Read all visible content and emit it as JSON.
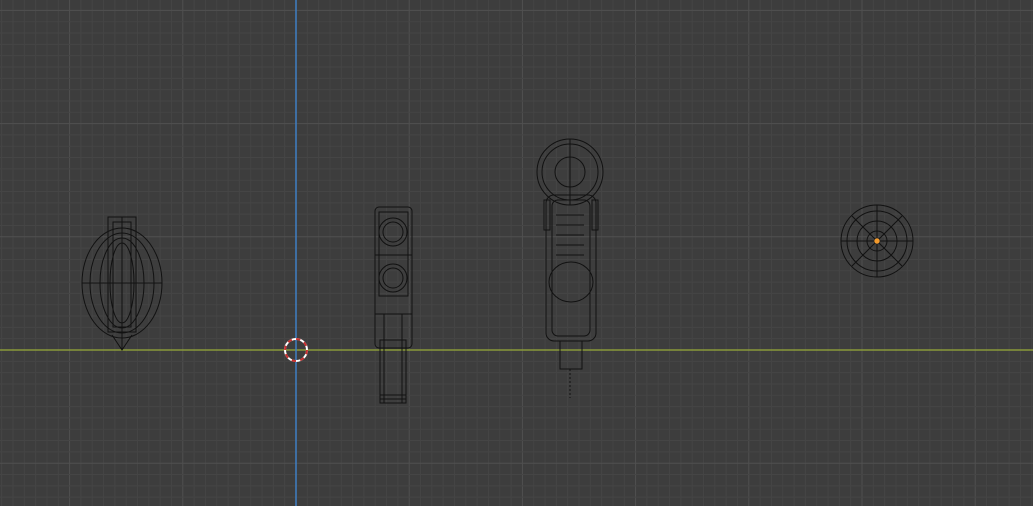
{
  "viewport": {
    "colors": {
      "background": "#3d3d3d",
      "grid_minor": "#454545",
      "grid_major": "#505050",
      "x_axis": "#8a9a3a",
      "y_axis": "#3f7fc4",
      "wire": "#111111",
      "selected_origin": "#f39a2c",
      "cursor_red": "#c83030",
      "cursor_white": "#ffffff"
    }
  }
}
